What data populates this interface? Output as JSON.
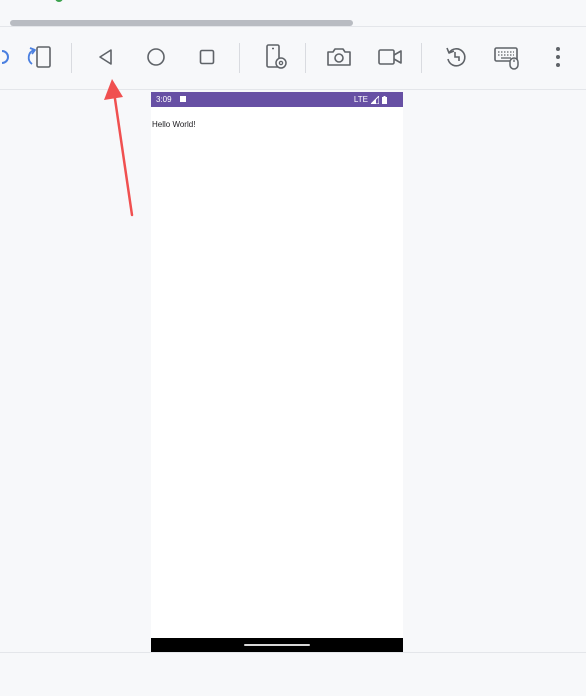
{
  "toolbar": {
    "buttons": [
      {
        "name": "rotate",
        "icon": "rotate-icon"
      },
      {
        "name": "back",
        "icon": "back-triangle-icon"
      },
      {
        "name": "home",
        "icon": "home-circle-icon"
      },
      {
        "name": "overview",
        "icon": "overview-square-icon"
      },
      {
        "name": "extended-controls",
        "icon": "device-settings-icon"
      },
      {
        "name": "screenshot",
        "icon": "camera-icon"
      },
      {
        "name": "screen-record",
        "icon": "video-camera-icon"
      },
      {
        "name": "snapshots",
        "icon": "snapshot-restore-icon"
      },
      {
        "name": "keyboard-input",
        "icon": "keyboard-mouse-icon"
      },
      {
        "name": "more",
        "icon": "more-vertical-icon"
      }
    ],
    "accent_color": "#4a7fe0",
    "icon_color": "#5f6368"
  },
  "device": {
    "status_bar": {
      "time": "3:09",
      "network": "LTE",
      "color": "#6750a4"
    },
    "content": {
      "text": "Hello World!"
    }
  },
  "annotation": {
    "arrow_color": "#f05050",
    "target": "back-button"
  }
}
